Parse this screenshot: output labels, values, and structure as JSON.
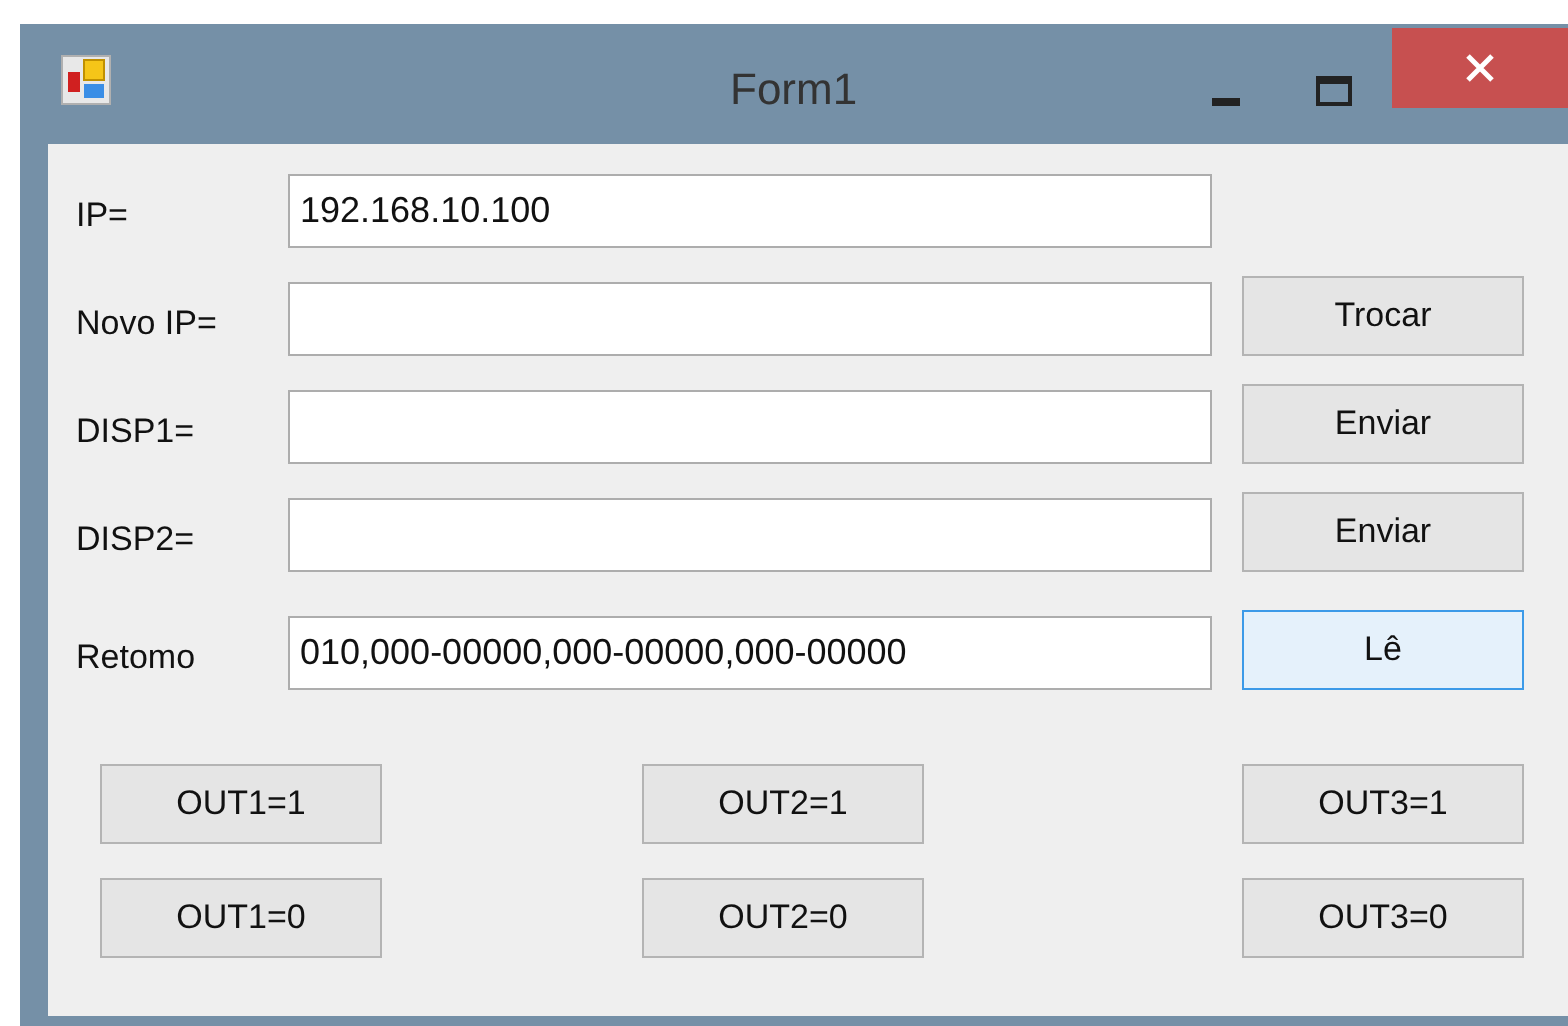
{
  "window": {
    "title": "Form1"
  },
  "rows": [
    {
      "label": "IP=",
      "value": "192.168.10.100"
    },
    {
      "label": "Novo IP=",
      "button": {
        "label": "Trocar",
        "focused": false
      }
    },
    {
      "label": "DISP1=",
      "button": {
        "label": "Enviar",
        "focused": false
      }
    },
    {
      "label": "DISP2=",
      "button": {
        "label": "Enviar",
        "focused": false
      }
    },
    {
      "label": "Retomo",
      "value": "010,000-00000,000-00000,000-00000",
      "button": {
        "label": "Lê",
        "focused": true
      }
    }
  ],
  "output_buttons": [
    [
      "OUT1=1",
      "OUT2=1",
      "OUT3=1"
    ],
    [
      "OUT1=0",
      "OUT2=0",
      "OUT3=0"
    ]
  ]
}
